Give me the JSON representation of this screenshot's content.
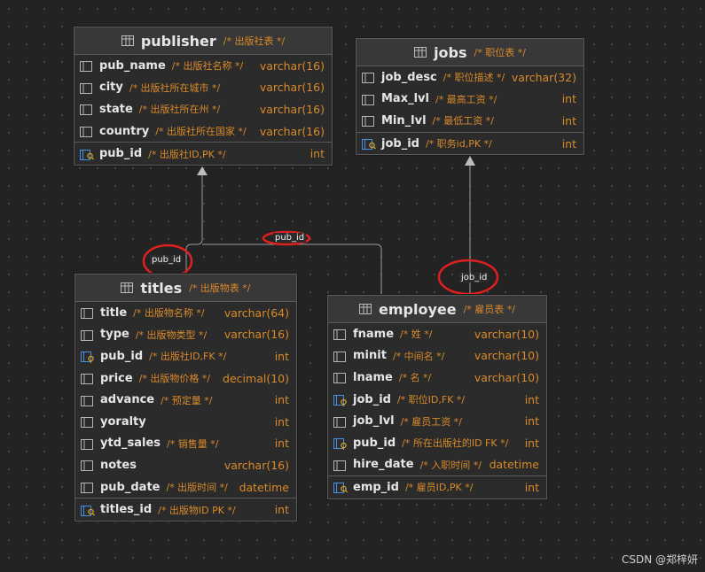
{
  "tables": {
    "publisher": {
      "name": "publisher",
      "comment": "/* 出版社表 */",
      "columns": [
        {
          "name": "pub_name",
          "comment": "/* 出版社名称 */",
          "type": "varchar(16)"
        },
        {
          "name": "city",
          "comment": "/* 出版社所在城市 */",
          "type": "varchar(16)"
        },
        {
          "name": "state",
          "comment": "/* 出版社所在州 */",
          "type": "varchar(16)"
        },
        {
          "name": "country",
          "comment": "/* 出版社所在国家 */",
          "type": "varchar(16)"
        }
      ],
      "pk": {
        "name": "pub_id",
        "comment": "/* 出版社ID,PK */",
        "type": "int"
      }
    },
    "jobs": {
      "name": "jobs",
      "comment": "/* 职位表 */",
      "columns": [
        {
          "name": "job_desc",
          "comment": "/* 职位描述 */",
          "type": "varchar(32)"
        },
        {
          "name": "Max_lvl",
          "comment": "/* 最高工资 */",
          "type": "int"
        },
        {
          "name": "Min_lvl",
          "comment": "/* 最低工资 */",
          "type": "int"
        }
      ],
      "pk": {
        "name": "job_id",
        "comment": "/* 职务id,PK */",
        "type": "int"
      }
    },
    "titles": {
      "name": "titles",
      "comment": "/* 出版物表 */",
      "columns": [
        {
          "name": "title",
          "comment": "/* 出版物名称 */",
          "type": "varchar(64)"
        },
        {
          "name": "type",
          "comment": "/* 出版物类型 */",
          "type": "varchar(16)"
        },
        {
          "name": "pub_id",
          "comment": "/* 出版社ID,FK */",
          "type": "int",
          "fk": true
        },
        {
          "name": "price",
          "comment": "/* 出版物价格 */",
          "type": "decimal(10)"
        },
        {
          "name": "advance",
          "comment": "/* 预定量 */",
          "type": "int"
        },
        {
          "name": "yoralty",
          "comment": "",
          "type": "int"
        },
        {
          "name": "ytd_sales",
          "comment": "/* 销售量 */",
          "type": "int"
        },
        {
          "name": "notes",
          "comment": "",
          "type": "varchar(16)"
        },
        {
          "name": "pub_date",
          "comment": "/* 出版时间 */",
          "type": "datetime"
        }
      ],
      "pk": {
        "name": "titles_id",
        "comment": "/* 出版物ID PK */",
        "type": "int"
      }
    },
    "employee": {
      "name": "employee",
      "comment": "/* 雇员表 */",
      "columns": [
        {
          "name": "fname",
          "comment": "/* 姓 */",
          "type": "varchar(10)"
        },
        {
          "name": "minit",
          "comment": "/* 中间名 */",
          "type": "varchar(10)"
        },
        {
          "name": "lname",
          "comment": "/* 名 */",
          "type": "varchar(10)"
        },
        {
          "name": "job_id",
          "comment": "/* 职位ID,FK */",
          "type": "int",
          "fk": true
        },
        {
          "name": "job_lvl",
          "comment": "/* 雇员工资 */",
          "type": "int"
        },
        {
          "name": "pub_id",
          "comment": "/* 所在出版社的ID FK */",
          "type": "int",
          "fk": true
        },
        {
          "name": "hire_date",
          "comment": "/* 入职时间 */",
          "type": "datetime"
        }
      ],
      "pk": {
        "name": "emp_id",
        "comment": "/* 雇员ID,PK */",
        "type": "int"
      }
    }
  },
  "relations": {
    "titles_pub": "pub_id",
    "employee_pub": "pub_id",
    "employee_job": "job_id"
  },
  "watermark": "CSDN @郑梓妍",
  "colors": {
    "accent": "#d98a2a",
    "highlight_circle": "#e02020",
    "key_icon": "#4a90e2"
  }
}
